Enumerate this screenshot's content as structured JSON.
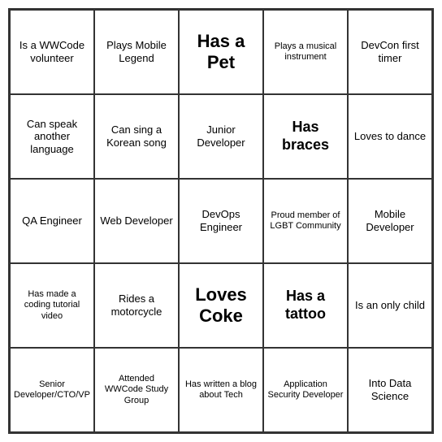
{
  "cells": [
    {
      "id": "r0c0",
      "text": "Is a WWCode volunteer",
      "size": "normal"
    },
    {
      "id": "r0c1",
      "text": "Plays Mobile Legend",
      "size": "normal"
    },
    {
      "id": "r0c2",
      "text": "Has a Pet",
      "size": "large"
    },
    {
      "id": "r0c3",
      "text": "Plays a musical instrument",
      "size": "small"
    },
    {
      "id": "r0c4",
      "text": "DevCon first timer",
      "size": "normal"
    },
    {
      "id": "r1c0",
      "text": "Can speak another language",
      "size": "normal"
    },
    {
      "id": "r1c1",
      "text": "Can sing a Korean song",
      "size": "normal"
    },
    {
      "id": "r1c2",
      "text": "Junior Developer",
      "size": "normal"
    },
    {
      "id": "r1c3",
      "text": "Has braces",
      "size": "medium"
    },
    {
      "id": "r1c4",
      "text": "Loves to dance",
      "size": "normal"
    },
    {
      "id": "r2c0",
      "text": "QA Engineer",
      "size": "normal"
    },
    {
      "id": "r2c1",
      "text": "Web Developer",
      "size": "normal"
    },
    {
      "id": "r2c2",
      "text": "DevOps Engineer",
      "size": "normal"
    },
    {
      "id": "r2c3",
      "text": "Proud member of LGBT Community",
      "size": "small"
    },
    {
      "id": "r2c4",
      "text": "Mobile Developer",
      "size": "normal"
    },
    {
      "id": "r3c0",
      "text": "Has made a coding tutorial video",
      "size": "small"
    },
    {
      "id": "r3c1",
      "text": "Rides a motorcycle",
      "size": "normal"
    },
    {
      "id": "r3c2",
      "text": "Loves Coke",
      "size": "large"
    },
    {
      "id": "r3c3",
      "text": "Has a tattoo",
      "size": "medium"
    },
    {
      "id": "r3c4",
      "text": "Is an only child",
      "size": "normal"
    },
    {
      "id": "r4c0",
      "text": "Senior Developer/CTO/VP",
      "size": "small"
    },
    {
      "id": "r4c1",
      "text": "Attended WWCode Study Group",
      "size": "small"
    },
    {
      "id": "r4c2",
      "text": "Has written a blog about Tech",
      "size": "small"
    },
    {
      "id": "r4c3",
      "text": "Application Security Developer",
      "size": "small"
    },
    {
      "id": "r4c4",
      "text": "Into Data Science",
      "size": "normal"
    }
  ]
}
